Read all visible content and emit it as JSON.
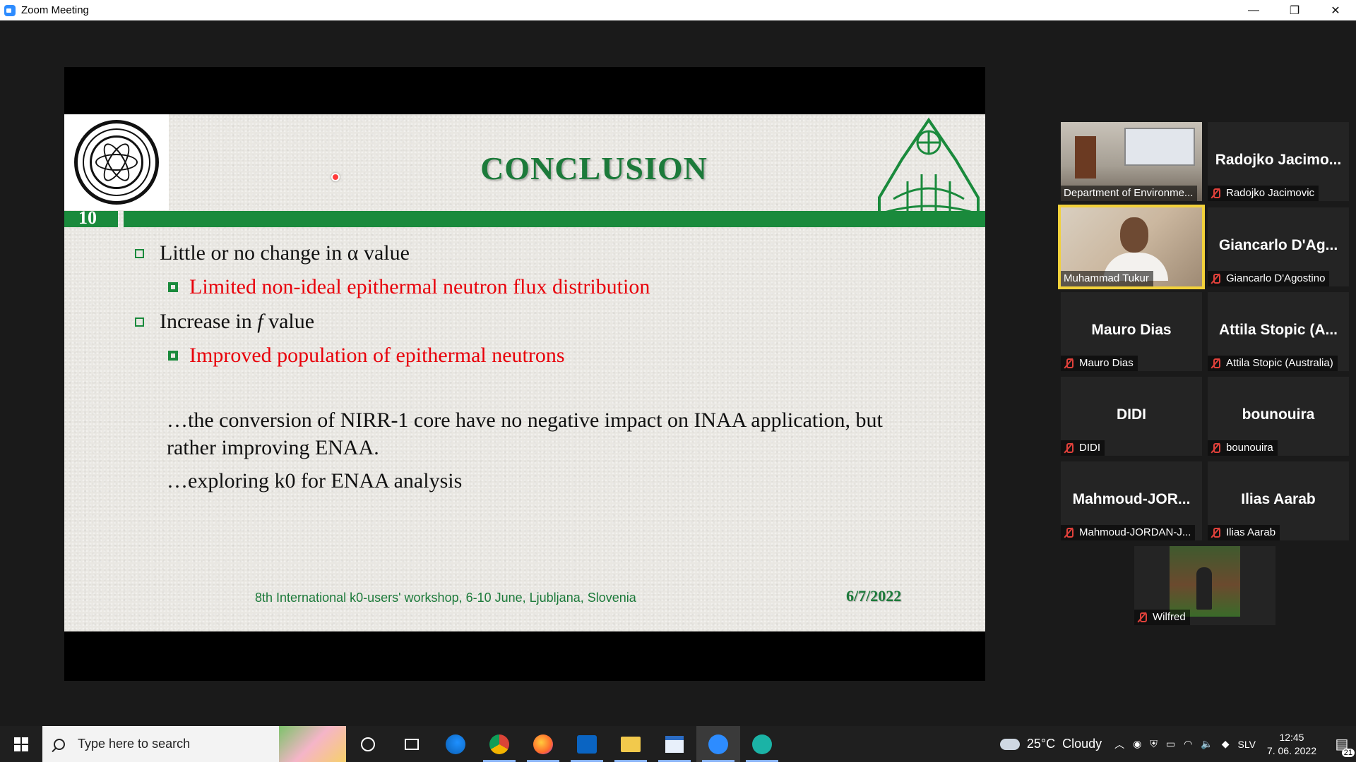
{
  "window": {
    "title": "Zoom Meeting",
    "controls": {
      "minimize": "—",
      "restore": "❐",
      "close": "✕"
    }
  },
  "slide": {
    "title": "CONCLUSION",
    "slide_number": "10",
    "bullets": [
      {
        "text": "Little or no change in α value",
        "sub": "Limited non-ideal epithermal neutron flux distribution"
      },
      {
        "text_prefix": "Increase in ",
        "text_italic": "f",
        "text_suffix": " value",
        "sub": "Improved population of epithermal neutrons"
      }
    ],
    "para1_line1": "…the conversion of NIRR-1 core have no negative impact on INAA application, but",
    "para1_line2": "rather improving ENAA.",
    "para2": "…exploring k0 for ENAA analysis",
    "footer": "8th International k0-users' workshop, 6-10 June, Ljubljana, Slovenia",
    "date": "6/7/2022",
    "accent_green": "#1a8a3c",
    "accent_red": "#e8000a"
  },
  "participants": [
    {
      "label": "Department of Environme...",
      "video": "room",
      "muted": false
    },
    {
      "big": "Radojko Jacimo...",
      "label": "Radojko Jacimovic",
      "muted": true
    },
    {
      "label": "Muhammad Tukur",
      "video": "face",
      "muted": false,
      "active": true
    },
    {
      "big": "Giancarlo D'Ag...",
      "label": "Giancarlo D'Agostino",
      "muted": true
    },
    {
      "big": "Mauro Dias",
      "label": "Mauro Dias",
      "muted": true
    },
    {
      "big": "Attila Stopic (A...",
      "label": "Attila Stopic (Australia)",
      "muted": true
    },
    {
      "big": "DIDI",
      "label": "DIDI",
      "muted": true
    },
    {
      "big": "bounouira",
      "label": "bounouira",
      "muted": true
    },
    {
      "big": "Mahmoud-JOR...",
      "label": "Mahmoud-JORDAN-J...",
      "muted": true
    },
    {
      "big": "Ilias Aarab",
      "label": "Ilias Aarab",
      "muted": true
    },
    {
      "label": "Wilfred",
      "video": "outdoor",
      "muted": true
    }
  ],
  "taskbar": {
    "search_placeholder": "Type here to search",
    "weather": "25°C  Cloudy",
    "lang": "SLV",
    "time": "12:45",
    "date": "7. 06. 2022",
    "notifications": "21",
    "apps": [
      "cortana-icon",
      "task-view-icon",
      "edge-icon",
      "chrome-icon",
      "firefox-icon",
      "outlook-icon",
      "file-explorer-icon",
      "notepad-icon",
      "zoom-icon",
      "eset-icon"
    ]
  }
}
